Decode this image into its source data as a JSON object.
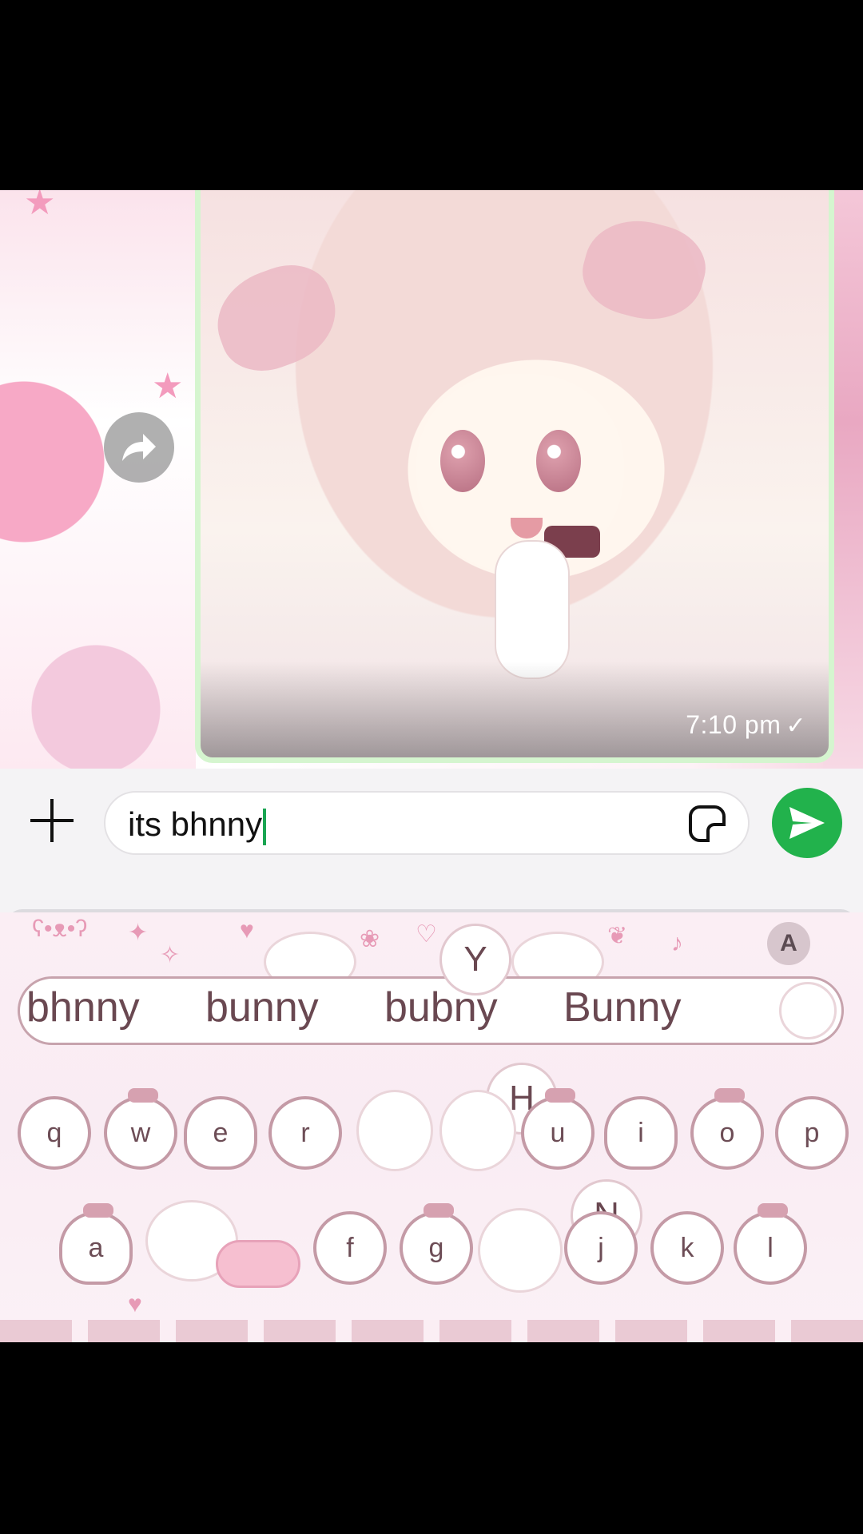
{
  "chat": {
    "message_time": "7:10 pm",
    "status_icon": "check-icon"
  },
  "input": {
    "value": "its bhnny",
    "add_icon": "plus-icon",
    "sticker_icon": "sticker-icon",
    "send_icon": "send-icon"
  },
  "keyboard": {
    "suggestions": [
      "bhnny",
      "bunny",
      "bubny",
      "Bunny"
    ],
    "popups": [
      "Y",
      "H",
      "N"
    ],
    "row1": [
      "q",
      "w",
      "e",
      "r",
      "u",
      "i",
      "o",
      "p"
    ],
    "row2": [
      "a",
      "f",
      "g",
      "j",
      "k",
      "l"
    ],
    "theme_button": "A"
  },
  "colors": {
    "send": "#22b24c",
    "bubble_border": "#d5f5cf",
    "key_border": "#c49aa6"
  }
}
